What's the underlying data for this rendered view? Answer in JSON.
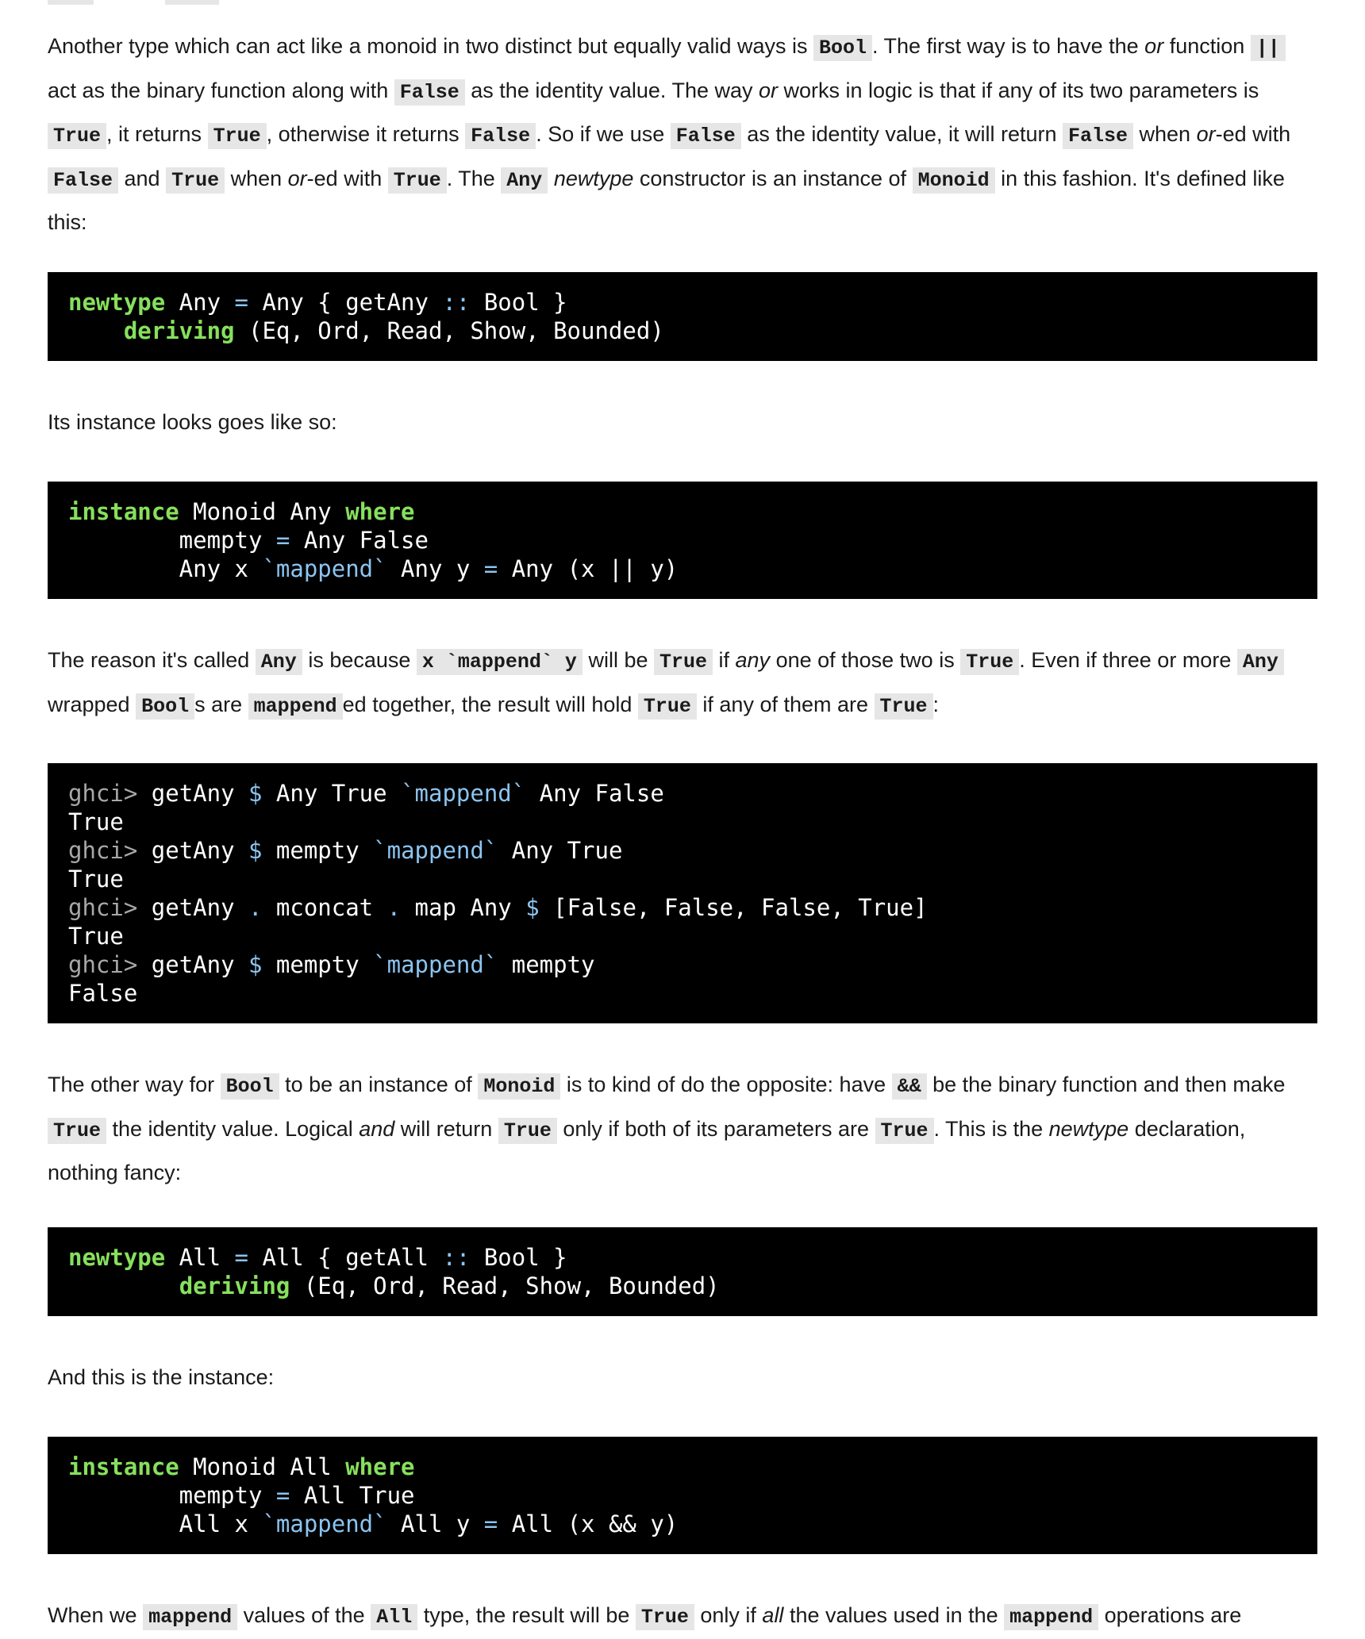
{
  "para1": {
    "t1": "Another type which can act like a monoid in two distinct but equally valid ways is ",
    "c1": "Bool",
    "t2": ". The first way is to have the ",
    "i1": "or",
    "t3": " function ",
    "c2": "||",
    "t4": " act as the binary function along with ",
    "c3": "False",
    "t5": " as the identity value. The way ",
    "i2": "or",
    "t6": " works in logic is that if any of its two parameters is ",
    "c4": "True",
    "t7": ", it returns ",
    "c5": "True",
    "t8": ", otherwise it returns ",
    "c6": "False",
    "t9": ". So if we use ",
    "c7": "False",
    "t10": " as the identity value, it will return ",
    "c8": "False",
    "t11": " when ",
    "i3": "or",
    "t12": "-ed with ",
    "c9": "False",
    "t13": " and ",
    "c10": "True",
    "t14": " when ",
    "i4": "or",
    "t15": "-ed with ",
    "c11": "True",
    "t16": ". The ",
    "c12": "Any",
    "t17": " ",
    "i5": "newtype",
    "t18": " constructor is an instance of ",
    "c13": "Monoid",
    "t19": " in this fashion. It's defined like this:"
  },
  "code1": {
    "l1_kw": "newtype",
    "l1_a": " Any ",
    "l1_op1": "=",
    "l1_b": " Any { getAny ",
    "l1_op2": "::",
    "l1_c": " Bool }",
    "l2_indent": "    ",
    "l2_kw": "deriving",
    "l2_a": " (Eq, Ord, Read, Show, Bounded)"
  },
  "para2": {
    "t1": "Its instance looks goes like so:"
  },
  "code2": {
    "l1_kw1": "instance",
    "l1_a": " Monoid Any ",
    "l1_kw2": "where",
    "l2_a": "        mempty ",
    "l2_op": "=",
    "l2_b": " Any False",
    "l3_a": "        Any x ",
    "l3_op1": "`mappend`",
    "l3_b": " Any y ",
    "l3_op2": "=",
    "l3_c": " Any (x || y)"
  },
  "para3": {
    "t1": "The reason it's called ",
    "c1": "Any",
    "t2": " is because ",
    "c2": "x `mappend` y",
    "t3": " will be ",
    "c3": "True",
    "t4": " if ",
    "i1": "any",
    "t5": " one of those two is ",
    "c4": "True",
    "t6": ". Even if three or more ",
    "c5": "Any",
    "t7": " wrapped ",
    "c6": "Bool",
    "t8": "s are ",
    "c7": "mappend",
    "t9": "ed together, the result will hold ",
    "c8": "True",
    "t10": " if any of them are ",
    "c9": "True",
    "t11": ":"
  },
  "code3": {
    "prompt": "ghci>",
    "l1_a": " getAny ",
    "l1_op1": "$",
    "l1_b": " Any True ",
    "l1_op2": "`mappend`",
    "l1_c": " Any False",
    "l2": "True",
    "l3_a": " getAny ",
    "l3_op1": "$",
    "l3_b": " mempty ",
    "l3_op2": "`mappend`",
    "l3_c": " Any True",
    "l4": "True",
    "l5_a": " getAny ",
    "l5_op1": ".",
    "l5_b": " mconcat ",
    "l5_op2": ".",
    "l5_c": " map Any ",
    "l5_op3": "$",
    "l5_d": " [False, False, False, True]",
    "l6": "True",
    "l7_a": " getAny ",
    "l7_op1": "$",
    "l7_b": " mempty ",
    "l7_op2": "`mappend`",
    "l7_c": " mempty",
    "l8": "False"
  },
  "para4": {
    "t1": "The other way for ",
    "c1": "Bool",
    "t2": " to be an instance of ",
    "c2": "Monoid",
    "t3": " is to kind of do the opposite: have ",
    "c3": "&&",
    "t4": " be the binary function and then make ",
    "c4": "True",
    "t5": " the identity value. Logical ",
    "i1": "and",
    "t6": " will return ",
    "c5": "True",
    "t7": " only if both of its parameters are ",
    "c6": "True",
    "t8": ". This is the ",
    "i2": "newtype",
    "t9": " declaration, nothing fancy:"
  },
  "code4": {
    "l1_kw": "newtype",
    "l1_a": " All ",
    "l1_op1": "=",
    "l1_b": " All { getAll ",
    "l1_op2": "::",
    "l1_c": " Bool }",
    "l2_indent": "        ",
    "l2_kw": "deriving",
    "l2_a": " (Eq, Ord, Read, Show, Bounded)"
  },
  "para5": {
    "t1": "And this is the instance:"
  },
  "code5": {
    "l1_kw1": "instance",
    "l1_a": " Monoid All ",
    "l1_kw2": "where",
    "l2_a": "        mempty ",
    "l2_op": "=",
    "l2_b": " All True",
    "l3_a": "        All x ",
    "l3_op1": "`mappend`",
    "l3_b": " All y ",
    "l3_op2": "=",
    "l3_c": " All (x && y)"
  },
  "para6": {
    "t1": "When we ",
    "c1": "mappend",
    "t2": " values of the ",
    "c2": "All",
    "t3": " type, the result will be ",
    "c3": "True",
    "t4": " only if ",
    "i1": "all",
    "t5": " the values used in the ",
    "c4": "mappend",
    "t6": " operations are"
  }
}
